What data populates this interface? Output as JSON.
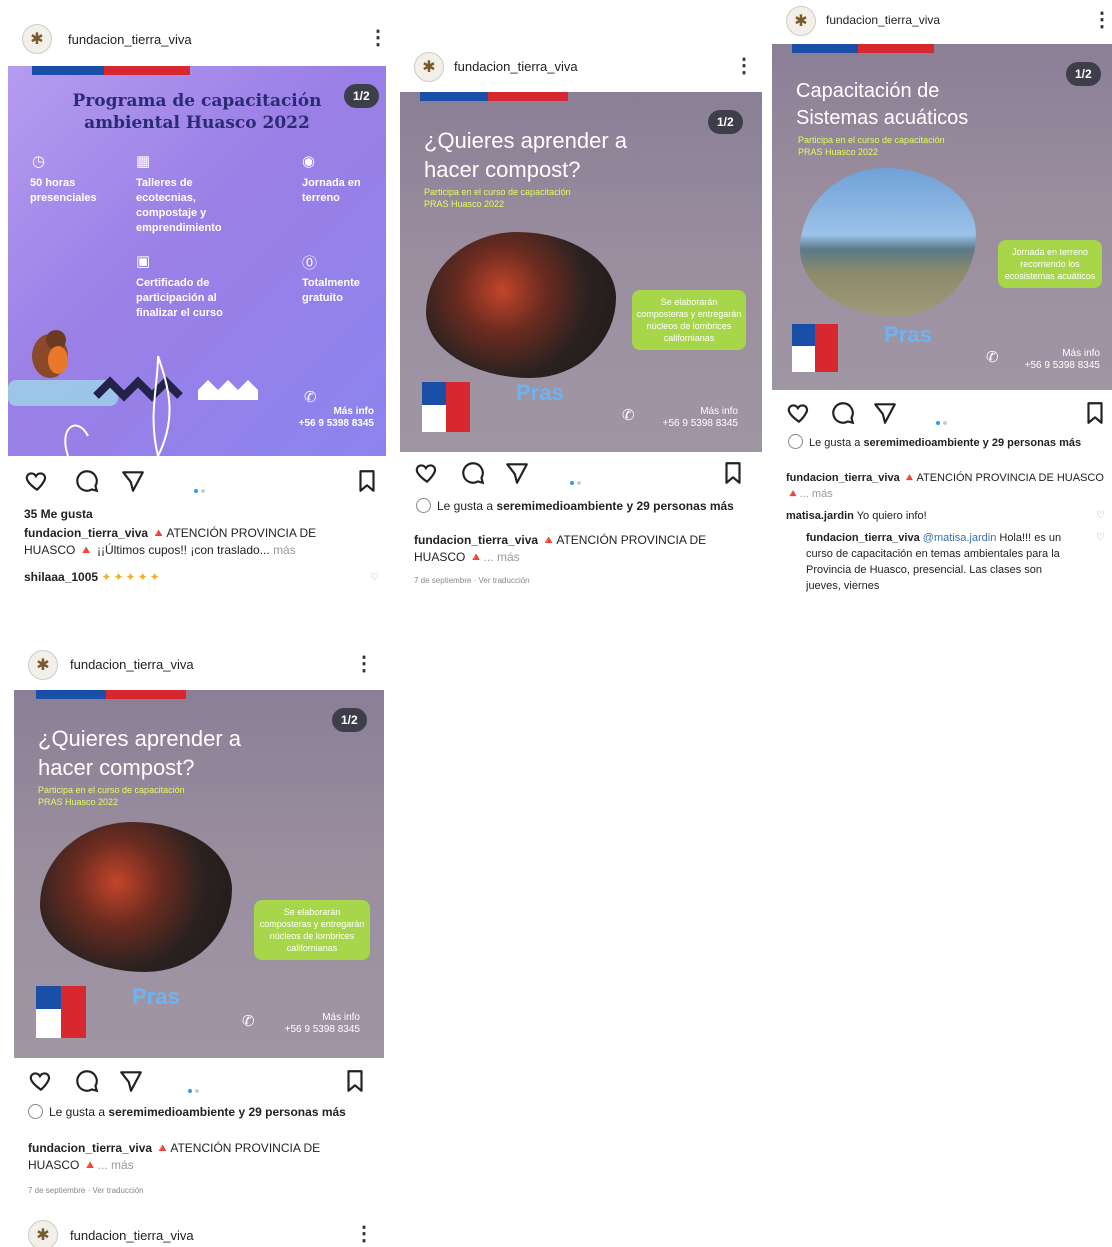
{
  "colors": {
    "flag_blue": "#1a4fa8",
    "flag_red": "#d8282f",
    "lime": "#e0ff5a",
    "green_box": "#a8d64a"
  },
  "post1": {
    "username": "fundacion_tierra_viva",
    "badge": "1/2",
    "title_line1": "Programa de capacitación",
    "title_line2": "ambiental Huasco 2022",
    "features": [
      {
        "icon": "clock-icon",
        "text": "50 horas presenciales"
      },
      {
        "icon": "grid-icon",
        "text": "Talleres de ecotecnias, compostaje y emprendimiento"
      },
      {
        "icon": "location-icon",
        "text": "Jornada en terreno"
      },
      {
        "icon": "certificate-icon",
        "text": "Certificado de participación al finalizar el curso"
      },
      {
        "icon": "dollar-icon",
        "text": "Totalmente gratuito"
      }
    ],
    "contact_label": "Más info",
    "contact_phone": "+56 9 5398 8345",
    "likes": "35 Me gusta",
    "caption_user": "fundacion_tierra_viva",
    "caption_text": "ATENCIÓN PROVINCIA DE HUASCO",
    "caption_more_text": "¡¡Últimos cupos!! ¡con traslado...",
    "more": "más",
    "comment_user": "shilaaa_1005"
  },
  "post2": {
    "username": "fundacion_tierra_viva",
    "badge": "1/2",
    "title_line1": "¿Quieres aprender a",
    "title_line2": "hacer compost?",
    "subtitle": "Participa en el curso de capacitación PRAS Huasco 2022",
    "box_text": "Se elaborarán composteras y entregarán núcleos de lombrices californianas",
    "brand": "Pras",
    "contact_label": "Más info",
    "contact_phone": "+56 9 5398 8345",
    "likes_prefix": "Le gusta a ",
    "likes_user": "seremimedioambiente",
    "likes_suffix": " y 29 personas más",
    "caption_user": "fundacion_tierra_viva",
    "caption_text": "ATENCIÓN PROVINCIA DE HUASCO",
    "more": "... más",
    "date": "7 de septiembre · Ver traducción"
  },
  "post3": {
    "username": "fundacion_tierra_viva",
    "badge": "1/2",
    "title_line1": "Capacitación de",
    "title_line2": "Sistemas acuáticos",
    "subtitle": "Participa en el curso de capacitación PRAS Huasco 2022",
    "box_text": "Jornada en terreno recorriendo los ecosistemas acuáticos",
    "brand": "Pras",
    "contact_label": "Más info",
    "contact_phone": "+56 9 5398 8345",
    "likes_prefix": "Le gusta a ",
    "likes_user": "seremimedioambiente",
    "likes_suffix": " y 29 personas más",
    "caption_user": "fundacion_tierra_viva",
    "caption_text": "ATENCIÓN PROVINCIA DE HUASCO",
    "more": "... más",
    "comment1_user": "matisa.jardin",
    "comment1_text": "Yo quiero info!",
    "reply_user": "fundacion_tierra_viva",
    "reply_mention": "@matisa.jardin",
    "reply_text": "Hola!!! es un curso de capacitación en temas ambientales para la Provincia de Huasco, presencial. Las clases son jueves, viernes"
  },
  "post4": {
    "username": "fundacion_tierra_viva",
    "badge": "1/2",
    "title_line1": "¿Quieres aprender a",
    "title_line2": "hacer compost?",
    "subtitle": "Participa en el curso de capacitación PRAS Huasco 2022",
    "box_text": "Se elaborarán composteras y entregarán núcleos de lombrices californianas",
    "brand": "Pras",
    "contact_label": "Más info",
    "contact_phone": "+56 9 5398 8345",
    "likes_prefix": "Le gusta a ",
    "likes_user": "seremimedioambiente",
    "likes_suffix": " y 29 personas más",
    "caption_user": "fundacion_tierra_viva",
    "caption_text": "ATENCIÓN PROVINCIA DE HUASCO",
    "more": "... más",
    "date": "7 de septiembre · Ver traducción"
  },
  "post5": {
    "username": "fundacion_tierra_viva"
  }
}
